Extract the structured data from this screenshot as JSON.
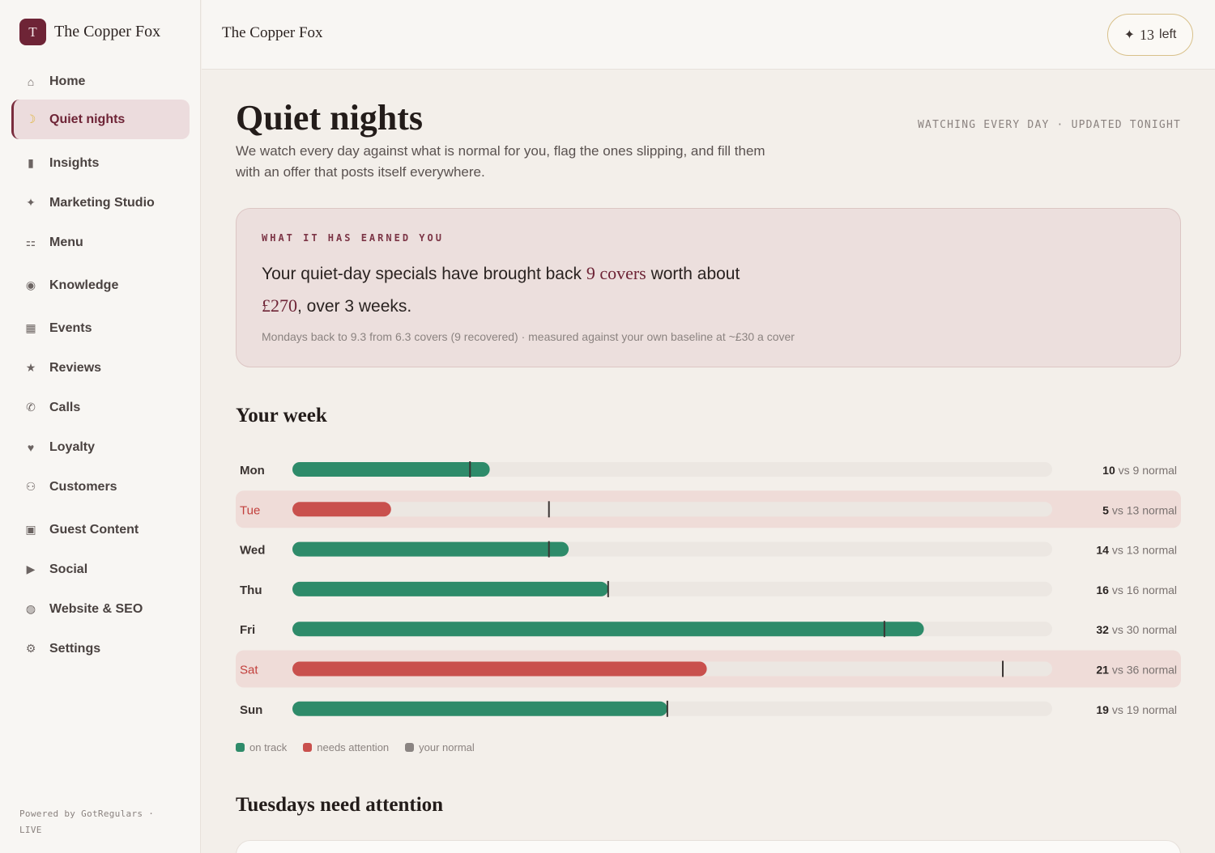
{
  "app": {
    "brand_initial": "T",
    "brand_name": "The Copper Fox",
    "topbar_title": "The Copper Fox",
    "credits_count": "13",
    "credits_label": "left",
    "powered_by": "Powered by GotRegulars · LIVE"
  },
  "sidebar": {
    "items": [
      {
        "label": "Home",
        "icon": "⌂",
        "icon_name": "home-icon"
      },
      {
        "label": "Quiet nights",
        "icon": "☽",
        "icon_name": "moon-icon",
        "active": true
      },
      {
        "label": "Insights",
        "icon": "▮",
        "icon_name": "bar-chart-icon"
      },
      {
        "label": "Marketing Studio",
        "icon": "✦",
        "icon_name": "sparkle-icon"
      },
      {
        "label": "Menu",
        "icon": "⚏",
        "icon_name": "menu-card-icon"
      },
      {
        "label": "Knowledge",
        "icon": "◉",
        "icon_name": "brain-icon"
      },
      {
        "label": "Events",
        "icon": "▦",
        "icon_name": "calendar-icon"
      },
      {
        "label": "Reviews",
        "icon": "★",
        "icon_name": "star-icon"
      },
      {
        "label": "Calls",
        "icon": "✆",
        "icon_name": "phone-icon"
      },
      {
        "label": "Loyalty",
        "icon": "♥",
        "icon_name": "heart-icon"
      },
      {
        "label": "Customers",
        "icon": "⚇",
        "icon_name": "people-icon"
      },
      {
        "label": "Guest Content",
        "icon": "▣",
        "icon_name": "clapper-icon"
      },
      {
        "label": "Social",
        "icon": "▶",
        "icon_name": "play-icon"
      },
      {
        "label": "Website & SEO",
        "icon": "◍",
        "icon_name": "globe-icon"
      },
      {
        "label": "Settings",
        "icon": "⚙",
        "icon_name": "gear-icon"
      }
    ]
  },
  "page": {
    "title": "Quiet nights",
    "status": "WATCHING EVERY DAY · UPDATED TONIGHT",
    "intro": "We watch every day against what is normal for you, flag the ones slipping, and fill them with an offer that posts itself everywhere."
  },
  "earned": {
    "kicker": "WHAT IT HAS EARNED YOU",
    "text_a": "Your quiet-day specials have brought back ",
    "highlight_covers": "9 covers",
    "text_b": " worth about ",
    "highlight_money": "£270",
    "text_c": ", over 3 weeks.",
    "note": "Mondays back to 9.3 from 6.3 covers (9 recovered) · measured against your own baseline at ~£30 a cover"
  },
  "week": {
    "heading": "Your week",
    "legend": {
      "on_track": "on track",
      "needs_attention": "needs attention",
      "your_normal": "your normal"
    },
    "vs_word": "vs",
    "normal_word": "normal"
  },
  "chart_data": {
    "type": "bar",
    "orientation": "horizontal",
    "categories": [
      "Mon",
      "Tue",
      "Wed",
      "Thu",
      "Fri",
      "Sat",
      "Sun"
    ],
    "series": [
      {
        "name": "actual",
        "values": [
          10,
          5,
          14,
          16,
          32,
          21,
          19
        ]
      },
      {
        "name": "your normal",
        "values": [
          9,
          13,
          13,
          16,
          30,
          36,
          19
        ]
      }
    ],
    "status": [
      "on track",
      "needs attention",
      "on track",
      "on track",
      "on track",
      "needs attention",
      "on track"
    ],
    "xlim": [
      0,
      36
    ],
    "colors": {
      "on_track": "#2e8b6a",
      "needs_attention": "#c9504d",
      "normal_marker": "#3a3432",
      "track": "#ece7e2",
      "attention_row": "#efdcd8"
    }
  },
  "next_section": {
    "heading": "Tuesdays need attention"
  }
}
